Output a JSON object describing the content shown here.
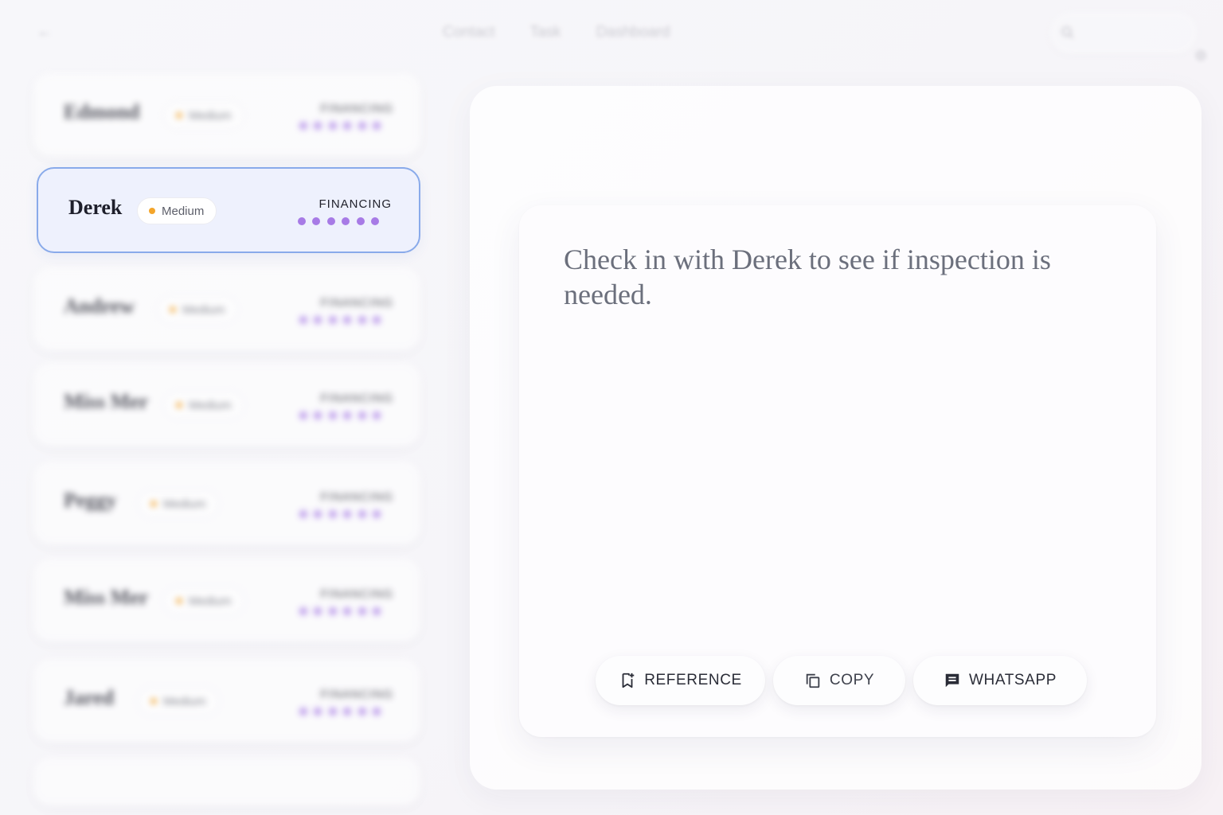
{
  "nav": {
    "links": [
      "Contact",
      "Task",
      "Dashboard"
    ]
  },
  "leads": [
    {
      "name": "Edmond",
      "priority": "Medium",
      "stage": "FINANCING",
      "steps": 6
    },
    {
      "name": "Derek",
      "priority": "Medium",
      "stage": "FINANCING",
      "steps": 6,
      "selected": true
    },
    {
      "name": "Andrew",
      "priority": "Medium",
      "stage": "FINANCING",
      "steps": 6
    },
    {
      "name": "Miss Mer",
      "priority": "Medium",
      "stage": "FINANCING",
      "steps": 6
    },
    {
      "name": "Peggy",
      "priority": "Medium",
      "stage": "FINANCING",
      "steps": 6
    },
    {
      "name": "Miss Mer",
      "priority": "Medium",
      "stage": "FINANCING",
      "steps": 6
    },
    {
      "name": "Jared",
      "priority": "Medium",
      "stage": "FINANCING",
      "steps": 6
    }
  ],
  "note": {
    "text": "Check in with Derek to see if inspection is needed."
  },
  "actions": {
    "reference": "REFERENCE",
    "copy": "COPY",
    "whatsapp": "WHATSAPP"
  },
  "colors": {
    "accent_border": "#89aaea",
    "selected_bg": "#eef1fd",
    "priority_dot": "#f4a52a",
    "progress_dot": "#a77be6"
  }
}
